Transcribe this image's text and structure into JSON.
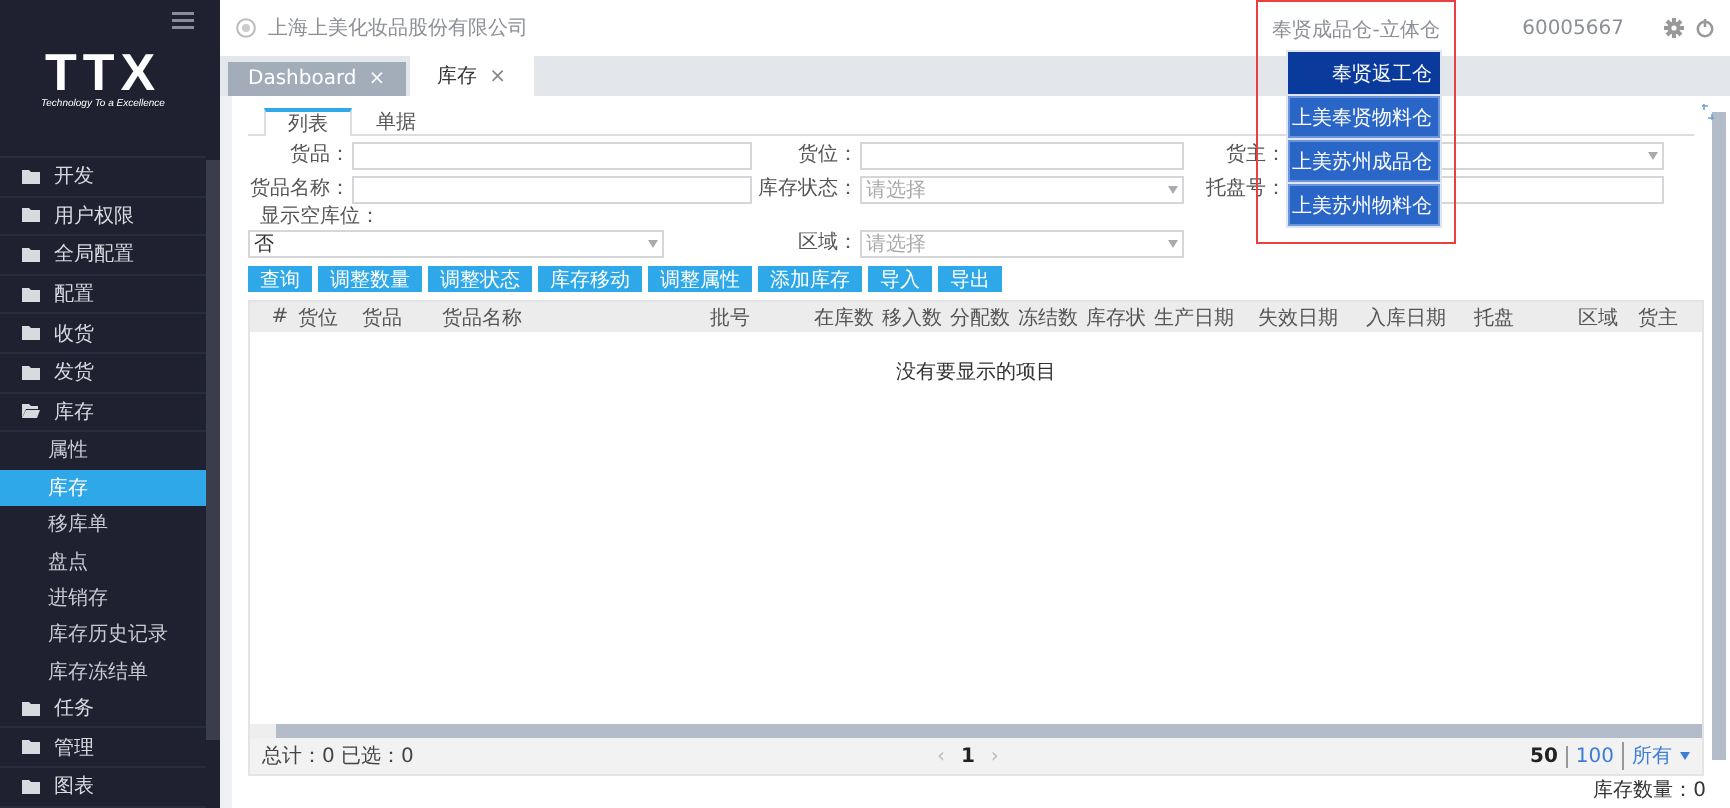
{
  "sidebar": {
    "logo": {
      "text": "TTX",
      "tagline": "Technology To a Excellence"
    },
    "items": [
      {
        "label": "开发",
        "expanded": false
      },
      {
        "label": "用户权限",
        "expanded": false
      },
      {
        "label": "全局配置",
        "expanded": false
      },
      {
        "label": "配置",
        "expanded": false
      },
      {
        "label": "收货",
        "expanded": false
      },
      {
        "label": "发货",
        "expanded": false
      },
      {
        "label": "库存",
        "expanded": true,
        "children": [
          {
            "label": "属性",
            "selected": false
          },
          {
            "label": "库存",
            "selected": true
          },
          {
            "label": "移库单",
            "selected": false
          },
          {
            "label": "盘点",
            "selected": false
          },
          {
            "label": "进销存",
            "selected": false
          },
          {
            "label": "库存历史记录",
            "selected": false
          },
          {
            "label": "库存冻结单",
            "selected": false
          }
        ]
      },
      {
        "label": "任务",
        "expanded": false
      },
      {
        "label": "管理",
        "expanded": false
      },
      {
        "label": "图表",
        "expanded": false
      }
    ]
  },
  "header": {
    "company": "上海上美化妆品股份有限公司",
    "warehouse": "奉贤成品仓-立体仓",
    "user_id": "60005667"
  },
  "warehouse_menu": [
    {
      "label": "奉贤返工仓",
      "selected": true
    },
    {
      "label": "上美奉贤物料仓",
      "selected": false
    },
    {
      "label": "上美苏州成品仓",
      "selected": false
    },
    {
      "label": "上美苏州物料仓",
      "selected": false
    }
  ],
  "tabs": [
    {
      "label": "Dashboard",
      "close": "×",
      "selected": false
    },
    {
      "label": "库存",
      "close": "×",
      "selected": true
    }
  ],
  "subtabs": [
    {
      "label": "列表",
      "selected": true
    },
    {
      "label": "单据",
      "selected": false
    }
  ],
  "filters": [
    [
      {
        "label": "货品：",
        "kind": "text"
      },
      {
        "label": "货位：",
        "kind": "text"
      },
      {
        "label": "货主：",
        "kind": "select"
      }
    ],
    [
      {
        "label": "货品名称：",
        "kind": "text"
      },
      {
        "label": "库存状态：",
        "kind": "select",
        "placeholder": "请选择"
      },
      {
        "label": "托盘号：",
        "kind": "text"
      }
    ],
    [
      {
        "label": "显示空库位：",
        "kind": "select",
        "value": "否",
        "stacked": true
      },
      {
        "label": "区域：",
        "kind": "select",
        "placeholder": "请选择"
      }
    ]
  ],
  "buttons": [
    "查询",
    "调整数量",
    "调整状态",
    "库存移动",
    "调整属性",
    "添加库存",
    "导入",
    "导出"
  ],
  "table": {
    "columns": [
      "#",
      "货位",
      "货品",
      "货品名称",
      "批号",
      "在库数",
      "移入数",
      "分配数",
      "冻结数",
      "库存状",
      "生产日期",
      "失效日期",
      "入库日期",
      "托盘",
      "区域",
      "货主"
    ],
    "empty_message": "没有要显示的项目"
  },
  "footer": {
    "totals": "总计：0 已选：0",
    "prev": "‹",
    "page": "1",
    "next": "›",
    "page_sizes": [
      {
        "label": "50",
        "selected": true
      },
      {
        "label": "100",
        "selected": false
      },
      {
        "label": "所有",
        "selected": false
      }
    ]
  },
  "summary": "库存数量：0"
}
